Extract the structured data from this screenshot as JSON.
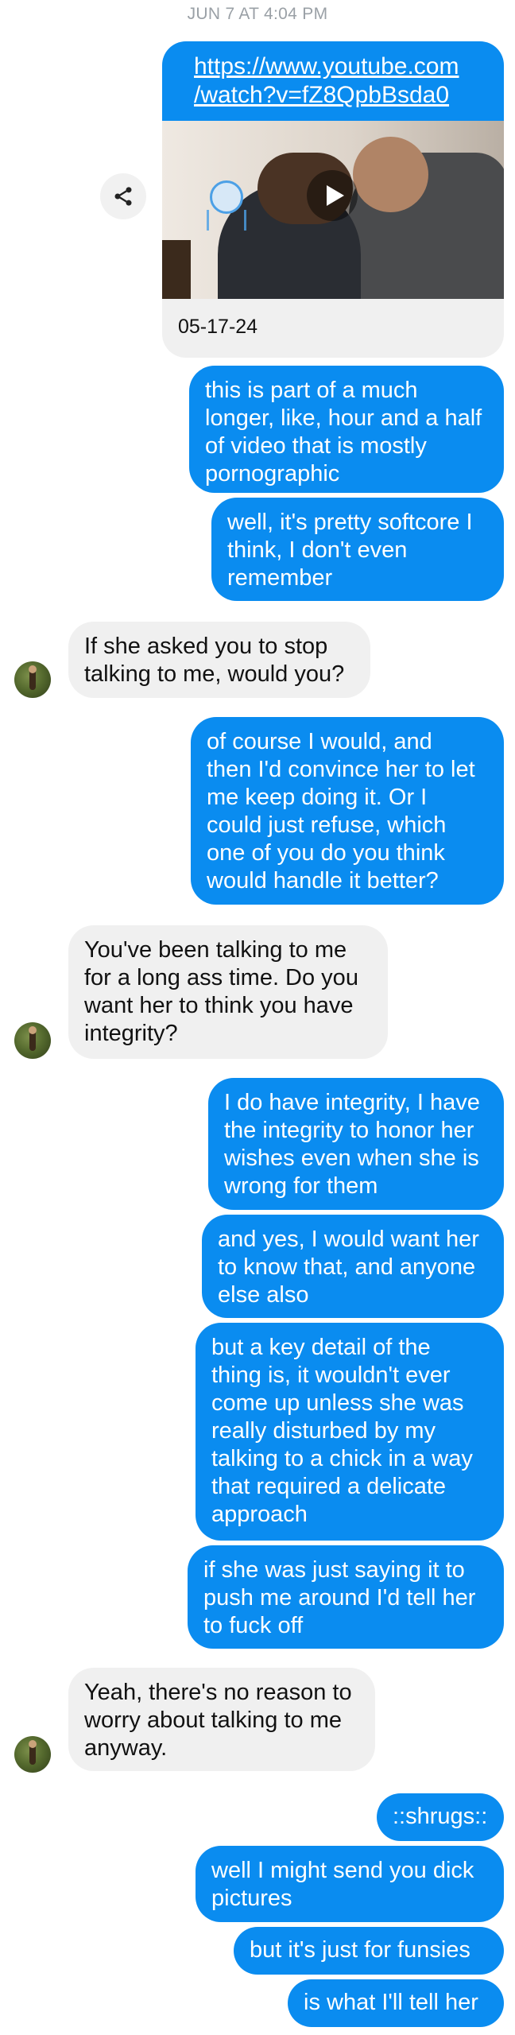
{
  "timestamp": "JUN 7 AT 4:04 PM",
  "link_card": {
    "url": "https://www.youtube.com\n/watch?v=fZ8QpbBsda0",
    "caption": "05-17-24"
  },
  "messages": [
    {
      "from": "me",
      "text": "this is part of a much\nlonger, like, hour and a half\nof video that is mostly\npornographic"
    },
    {
      "from": "me",
      "text": "well, it's pretty softcore I\nthink, I don't even\nremember"
    },
    {
      "from": "them",
      "text": "If she asked you to stop\ntalking to me, would you?"
    },
    {
      "from": "me",
      "text": "of course I would, and\nthen I'd convince her to let\nme keep doing it. Or I\ncould just refuse, which\none of you do you think\nwould handle it better?"
    },
    {
      "from": "them",
      "text": "You've been talking to me\nfor a long ass time. Do you\nwant her to think you have\nintegrity?"
    },
    {
      "from": "me",
      "text": "I do have integrity, I have\nthe integrity to honor her\nwishes even when she is\nwrong for them"
    },
    {
      "from": "me",
      "text": "and yes, I would want her\nto know that, and anyone\nelse also"
    },
    {
      "from": "me",
      "text": "but a key detail of the\nthing is, it wouldn't ever\ncome up unless she was\nreally disturbed by my\ntalking to a chick in a way\nthat required a delicate\napproach"
    },
    {
      "from": "me",
      "text": "if she was just saying it to\npush me around I'd tell her\nto fuck off"
    },
    {
      "from": "them",
      "text": "Yeah, there's no reason to\nworry about talking to me\nanyway."
    },
    {
      "from": "me",
      "text": "::shrugs::"
    },
    {
      "from": "me",
      "text": "well I might send you dick\npictures"
    },
    {
      "from": "me",
      "text": "but it's just for funsies"
    },
    {
      "from": "me",
      "text": "is what I'll tell her"
    }
  ],
  "colors": {
    "outgoing": "#0a8cf0",
    "incoming": "#f0f0f0"
  }
}
